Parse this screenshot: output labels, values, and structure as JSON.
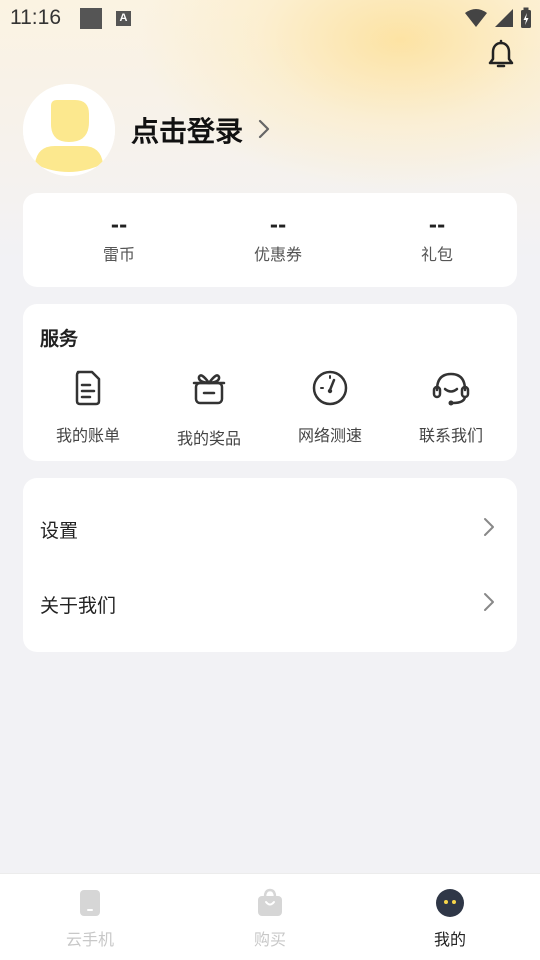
{
  "status_bar": {
    "time": "11:16"
  },
  "profile": {
    "login_label": "点击登录"
  },
  "stats": [
    {
      "value": "--",
      "label": "雷币"
    },
    {
      "value": "--",
      "label": "优惠券"
    },
    {
      "value": "--",
      "label": "礼包"
    }
  ],
  "services": {
    "title": "服务",
    "items": [
      {
        "label": "我的账单",
        "icon": "bill-icon"
      },
      {
        "label": "我的奖品",
        "icon": "prize-icon"
      },
      {
        "label": "网络测速",
        "icon": "speedometer-icon"
      },
      {
        "label": "联系我们",
        "icon": "headset-icon"
      }
    ]
  },
  "menu": {
    "items": [
      {
        "label": "设置"
      },
      {
        "label": "关于我们"
      }
    ]
  },
  "tab_bar": {
    "tabs": [
      {
        "label": "云手机",
        "active": false
      },
      {
        "label": "购买",
        "active": false
      },
      {
        "label": "我的",
        "active": true
      }
    ]
  },
  "colors": {
    "accent_yellow": "#FCE88E",
    "background": "#F2F2F5",
    "inactive_tab": "#C8C8C8"
  }
}
